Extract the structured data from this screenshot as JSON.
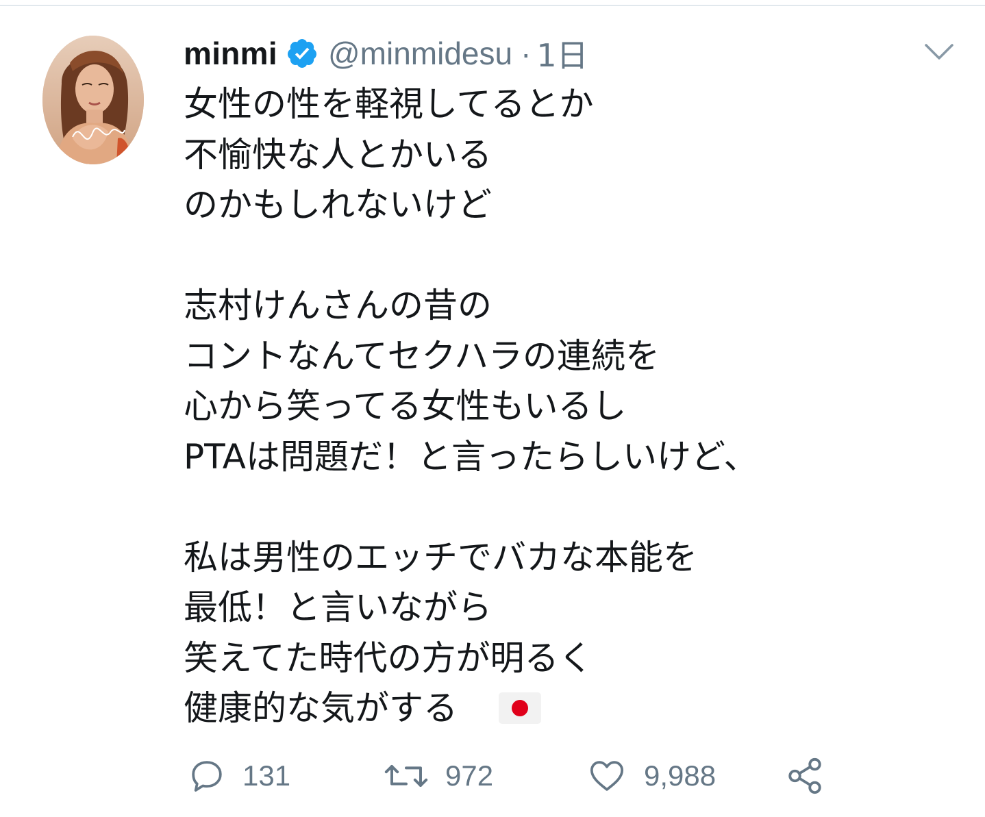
{
  "tweet": {
    "display_name": "minmi",
    "handle": "@minmidesu",
    "separator": "·",
    "time": "1日",
    "lines": [
      "女性の性を軽視してるとか",
      "不愉快な人とかいる",
      "のかもしれないけど",
      "",
      "志村けんさんの昔の",
      "コントなんてセクハラの連続を",
      "心から笑ってる女性もいるし",
      "PTAは問題だ！と言ったらしいけど、",
      "",
      "私は男性のエッチでバカな本能を",
      "最低！と言いながら",
      "笑えてた時代の方が明るく",
      "健康的な気がする"
    ],
    "emoji": "flag-japan",
    "avatar_signature": "Minmi"
  },
  "actions": {
    "reply_count": "131",
    "retweet_count": "972",
    "like_count": "9,988"
  },
  "icons": {
    "verified": "verified-badge-icon",
    "caret": "chevron-down-icon",
    "reply": "reply-icon",
    "retweet": "retweet-icon",
    "like": "heart-icon",
    "share": "share-icon"
  },
  "colors": {
    "text": "#14171a",
    "muted": "#657786",
    "verified": "#1da1f2",
    "divider": "#e1e8ed"
  }
}
